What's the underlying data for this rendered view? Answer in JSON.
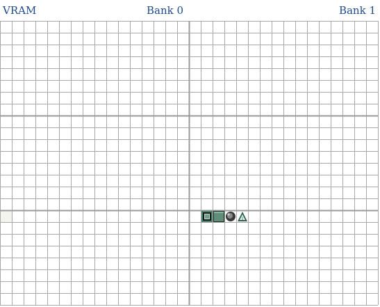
{
  "header": {
    "title": "VRAM",
    "bank0_label": "Bank 0",
    "bank1_label": "Bank 1",
    "label_color": "#1e4a8c"
  },
  "grid": {
    "line_color": "#a8a8a8",
    "divider_color": "#9a9a9a",
    "highlight_color": "#f4f4ee"
  },
  "tiles": [
    {
      "name": "framed-square-tile",
      "colors": [
        "#4f7f6f",
        "#102018",
        "#c6dccf",
        "#6f9f8a"
      ]
    },
    {
      "name": "solid-square-tile",
      "colors": [
        "#5f8f7a",
        "#1a2a22",
        "#8fb5a5"
      ]
    },
    {
      "name": "dark-ball-tile",
      "colors": [
        "#3a3a3a",
        "#8a8a8a",
        "#cfcfcf"
      ]
    },
    {
      "name": "triangle-tile",
      "colors": [
        "#2f6050",
        "#9ccab5",
        "#e8f2ec"
      ]
    }
  ]
}
